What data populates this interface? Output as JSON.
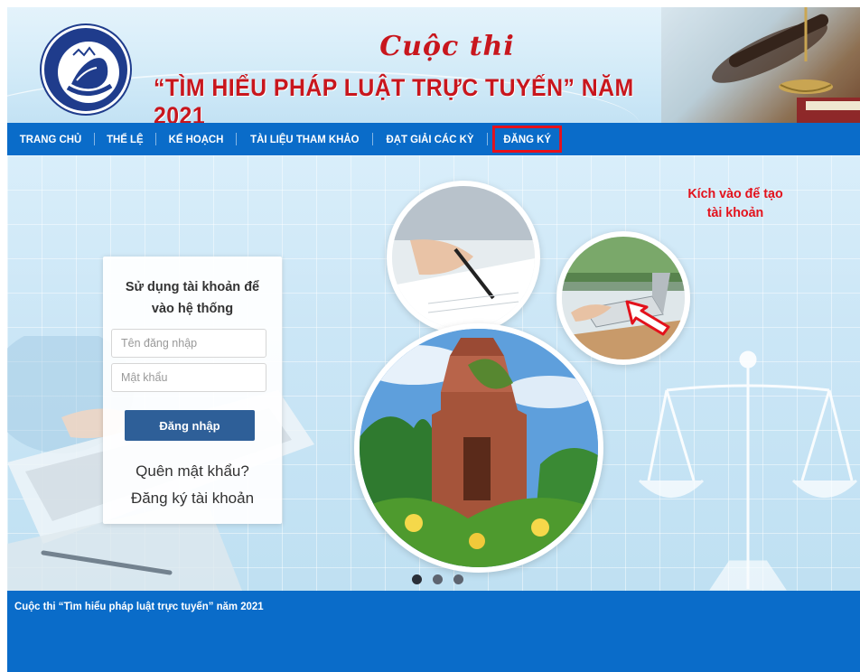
{
  "header": {
    "title_line1": "Cuộc thi",
    "title_line2": "“TÌM HIỂU PHÁP LUẬT TRỰC TUYẾN” NĂM 2021",
    "logo_icon": "logo-emblem-icon",
    "colors": {
      "title": "#c8161d",
      "banner": "#d3ebf8"
    }
  },
  "nav": {
    "items": [
      {
        "label": "TRANG CHỦ"
      },
      {
        "label": "THỂ LỆ"
      },
      {
        "label": "KẾ HOẠCH"
      },
      {
        "label": "TÀI LIỆU THAM KHẢO"
      },
      {
        "label": "ĐẠT GIẢI CÁC KỲ"
      },
      {
        "label": "ĐĂNG KÝ"
      }
    ],
    "highlighted": "ĐĂNG KÝ",
    "colors": {
      "bar": "#0a6cc9",
      "highlight_border": "#e8101a"
    }
  },
  "annotation": {
    "text_line1": "Kích vào để tạo",
    "text_line2": "tài khoản",
    "arrow_icon": "red-outline-arrow-icon",
    "color": "#e3121c"
  },
  "login": {
    "title_line1": "Sử dụng tài khoản để",
    "title_line2": "vào hệ thống",
    "username_placeholder": "Tên đăng nhập",
    "password_placeholder": "Mật khẩu",
    "submit_label": "Đăng nhập",
    "forgot_label": "Quên mật khẩu?",
    "register_label": "Đăng ký tài khoản",
    "button_color": "#2e5f98"
  },
  "slider": {
    "dots": 3,
    "active_index": 0
  },
  "footer": {
    "text": "Cuộc thi “Tìm hiểu pháp luật trực tuyến” năm 2021",
    "color": "#0a6cc9"
  }
}
